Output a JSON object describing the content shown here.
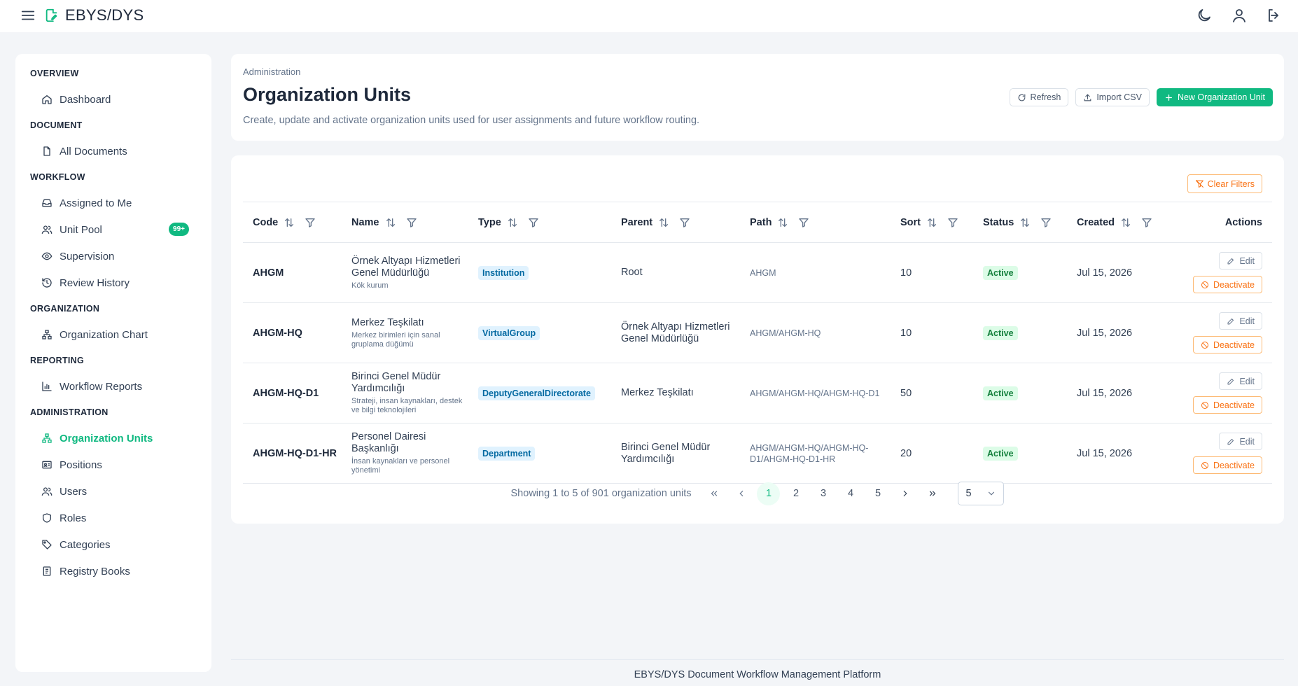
{
  "app": {
    "title": "EBYS/DYS"
  },
  "sidebar": {
    "sections": [
      {
        "title": "OVERVIEW",
        "items": [
          {
            "label": "Dashboard",
            "icon": "home-icon"
          }
        ]
      },
      {
        "title": "DOCUMENT",
        "items": [
          {
            "label": "All Documents",
            "icon": "file-icon"
          }
        ]
      },
      {
        "title": "WORKFLOW",
        "items": [
          {
            "label": "Assigned to Me",
            "icon": "inbox-icon"
          },
          {
            "label": "Unit Pool",
            "icon": "users-icon",
            "badge": "99+"
          },
          {
            "label": "Supervision",
            "icon": "eye-icon"
          },
          {
            "label": "Review History",
            "icon": "history-icon"
          }
        ]
      },
      {
        "title": "ORGANIZATION",
        "items": [
          {
            "label": "Organization Chart",
            "icon": "org-chart-icon"
          }
        ]
      },
      {
        "title": "REPORTING",
        "items": [
          {
            "label": "Workflow Reports",
            "icon": "bar-chart-icon"
          }
        ]
      },
      {
        "title": "ADMINISTRATION",
        "items": [
          {
            "label": "Organization Units",
            "icon": "org-chart-icon",
            "active": true
          },
          {
            "label": "Positions",
            "icon": "id-card-icon"
          },
          {
            "label": "Users",
            "icon": "users-icon"
          },
          {
            "label": "Roles",
            "icon": "shield-icon"
          },
          {
            "label": "Categories",
            "icon": "tag-icon"
          },
          {
            "label": "Registry Books",
            "icon": "book-icon"
          }
        ]
      }
    ]
  },
  "header": {
    "breadcrumb": "Administration",
    "title": "Organization Units",
    "description": "Create, update and activate organization units used for user assignments and future workflow routing.",
    "refresh_label": "Refresh",
    "import_label": "Import CSV",
    "new_label": "New Organization Unit"
  },
  "table": {
    "clear_filters_label": "Clear Filters",
    "columns": [
      "Code",
      "Name",
      "Type",
      "Parent",
      "Path",
      "Sort",
      "Status",
      "Created",
      "Actions"
    ],
    "edit_label": "Edit",
    "deactivate_label": "Deactivate",
    "rows": [
      {
        "code": "AHGM",
        "name": "Örnek Altyapı Hizmetleri Genel Müdürlüğü",
        "description": "Kök kurum",
        "type": "Institution",
        "parent": "Root",
        "path": "AHGM",
        "sort": "10",
        "status": "Active",
        "created": "Jul 15, 2026"
      },
      {
        "code": "AHGM-HQ",
        "name": "Merkez Teşkilatı",
        "description": "Merkez birimleri için sanal gruplama düğümü",
        "type": "VirtualGroup",
        "parent": "Örnek Altyapı Hizmetleri Genel Müdürlüğü",
        "path": "AHGM/AHGM-HQ",
        "sort": "10",
        "status": "Active",
        "created": "Jul 15, 2026"
      },
      {
        "code": "AHGM-HQ-D1",
        "name": "Birinci Genel Müdür Yardımcılığı",
        "description": "Strateji, insan kaynakları, destek ve bilgi teknolojileri",
        "type": "DeputyGeneralDirectorate",
        "parent": "Merkez Teşkilatı",
        "path": "AHGM/AHGM-HQ/AHGM-HQ-D1",
        "sort": "50",
        "status": "Active",
        "created": "Jul 15, 2026"
      },
      {
        "code": "AHGM-HQ-D1-HR",
        "name": "Personel Dairesi Başkanlığı",
        "description": "İnsan kaynakları ve personel yönetimi",
        "type": "Department",
        "parent": "Birinci Genel Müdür Yardımcılığı",
        "path": "AHGM/AHGM-HQ/AHGM-HQ-D1/AHGM-HQ-D1-HR",
        "sort": "20",
        "status": "Active",
        "created": "Jul 15, 2026"
      }
    ]
  },
  "pagination": {
    "summary": "Showing 1 to 5 of 901 organization units",
    "pages": [
      "1",
      "2",
      "3",
      "4",
      "5"
    ],
    "current_page": "1",
    "rows_per_page": "5"
  },
  "footer": {
    "text": "EBYS/DYS Document Workflow Management Platform"
  },
  "colors": {
    "accent": "#10b981",
    "warning": "#f97316",
    "info": "#0369a1"
  }
}
